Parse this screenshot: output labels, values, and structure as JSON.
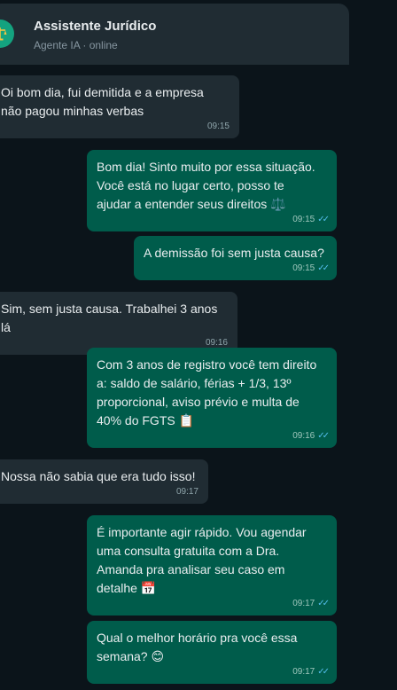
{
  "header": {
    "title": "Assistente Jurídico",
    "subtitle": "Agente IA · online"
  },
  "messages": [
    {
      "dir": "in",
      "text": "Oi bom dia, fui demitida e a empresa\nnão pagou minhas verbas",
      "time": "09:15"
    },
    {
      "dir": "out",
      "text": "Bom dia! Sinto muito por essa situação.\nVocê está no lugar certo, posso te\najudar a entender seus direitos ⚖️",
      "time": "09:15",
      "ticks": "✓✓"
    },
    {
      "dir": "out",
      "text": "A demissão foi sem justa causa?",
      "time": "09:15",
      "ticks": "✓✓"
    },
    {
      "dir": "in",
      "text": "Sim, sem justa causa. Trabalhei 3 anos lá",
      "time": "09:16"
    },
    {
      "dir": "out",
      "text": "Com 3 anos de registro você tem direito\na: saldo de salário, férias + 1/3, 13º\nproporcional, aviso prévio e multa de\n40% do FGTS 📋",
      "time": "09:16",
      "ticks": "✓✓"
    },
    {
      "dir": "in",
      "text": "Nossa não sabia que era tudo isso!",
      "time": "09:17"
    },
    {
      "dir": "out",
      "text": "É importante agir rápido. Vou agendar\numa consulta gratuita com a Dra.\nAmanda pra analisar seu caso em\ndetalhe 📅",
      "time": "09:17",
      "ticks": "✓✓"
    },
    {
      "dir": "out",
      "text": "Qual o melhor horário pra você essa\nsemana? 😊",
      "time": "09:17",
      "ticks": "✓✓"
    }
  ]
}
